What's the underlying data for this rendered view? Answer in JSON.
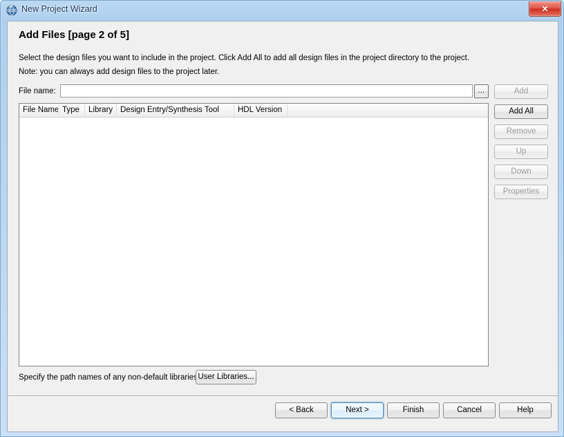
{
  "window": {
    "title": "New Project Wizard",
    "icon": "quartus-globe-icon",
    "close_label": "✕"
  },
  "page": {
    "heading": "Add Files [page 2 of 5]",
    "description_line1": "Select the design files you want to include in the project. Click Add All to add all design files in the project directory to the project.",
    "description_line2": "Note: you can always add design files to the project later."
  },
  "file_name_row": {
    "label": "File name:",
    "value": "",
    "placeholder": "",
    "browse_label": "...",
    "add_label": "Add"
  },
  "side_buttons": [
    {
      "label": "Add All",
      "name": "add-all-button",
      "enabled": true
    },
    {
      "label": "Remove",
      "name": "remove-button",
      "enabled": false
    },
    {
      "label": "Up",
      "name": "up-button",
      "enabled": false
    },
    {
      "label": "Down",
      "name": "down-button",
      "enabled": false
    },
    {
      "label": "Properties",
      "name": "properties-button",
      "enabled": false
    }
  ],
  "file_table": {
    "columns": [
      "File Name",
      "Type",
      "Library",
      "Design Entry/Synthesis Tool",
      "HDL Version",
      ""
    ],
    "rows": []
  },
  "user_libraries": {
    "text": "Specify the path names of any non-default libraries.",
    "button_label": "User Libraries..."
  },
  "footer": {
    "back_label": "< Back",
    "next_label": "Next >",
    "finish_label": "Finish",
    "cancel_label": "Cancel",
    "help_label": "Help"
  },
  "colors": {
    "titlebar_blue": "#b6d4f0",
    "dialog_bg": "#f0f0f0",
    "close_red": "#cf2d1f",
    "focus_blue": "#3c7fb1"
  }
}
